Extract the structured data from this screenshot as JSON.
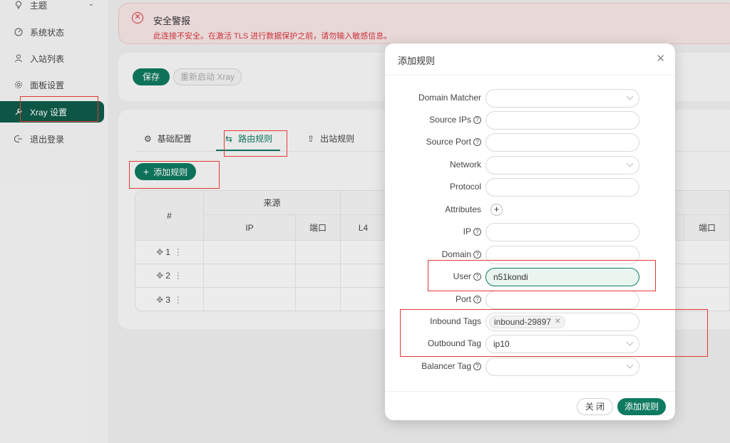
{
  "sidebar": {
    "items": [
      {
        "label": "主题",
        "icon": "bulb-icon"
      },
      {
        "label": "系统状态",
        "icon": "dashboard-icon"
      },
      {
        "label": "入站列表",
        "icon": "user-icon"
      },
      {
        "label": "面板设置",
        "icon": "gear-icon"
      },
      {
        "label": "Xray 设置",
        "icon": "tool-icon"
      },
      {
        "label": "退出登录",
        "icon": "logout-icon"
      }
    ]
  },
  "alert": {
    "title": "安全警报",
    "description": "此连接不安全。在激活 TLS 进行数据保护之前，请勿输入敏感信息。"
  },
  "toolbar": {
    "save_label": "保存",
    "restart_label": "重新启动 Xray"
  },
  "tabs": [
    {
      "label": "基础配置",
      "icon": "gear-icon"
    },
    {
      "label": "路由规则",
      "icon": "swap-icon"
    },
    {
      "label": "出站规则",
      "icon": "upload-icon"
    }
  ],
  "add_rule_label": "添加规则",
  "table": {
    "col_index": "#",
    "group_source": "来源",
    "col_ip": "IP",
    "col_port": "端口",
    "col_l4": "L4",
    "col_port_right": "端口",
    "rows": [
      "1",
      "2",
      "3"
    ]
  },
  "modal": {
    "title": "添加规则",
    "fields": {
      "domain_matcher": {
        "label": "Domain Matcher",
        "value": ""
      },
      "source_ips": {
        "label": "Source IPs",
        "value": ""
      },
      "source_port": {
        "label": "Source Port",
        "value": ""
      },
      "network": {
        "label": "Network",
        "value": ""
      },
      "protocol": {
        "label": "Protocol",
        "value": ""
      },
      "attributes": {
        "label": "Attributes"
      },
      "ip": {
        "label": "IP",
        "value": ""
      },
      "domain": {
        "label": "Domain",
        "value": ""
      },
      "user": {
        "label": "User",
        "value": "n51kondi"
      },
      "port": {
        "label": "Port",
        "value": ""
      },
      "inbound_tags": {
        "label": "Inbound Tags",
        "tag": "inbound-29897"
      },
      "outbound_tag": {
        "label": "Outbound Tag",
        "value": "ip10"
      },
      "balancer_tag": {
        "label": "Balancer Tag",
        "value": ""
      }
    },
    "cancel_label": "关 闭",
    "submit_label": "添加规则"
  },
  "colors": {
    "primary": "#0e7a5f",
    "sidebar_active": "#0e5c4a",
    "danger": "#d9363e",
    "highlight": "#e53935"
  }
}
